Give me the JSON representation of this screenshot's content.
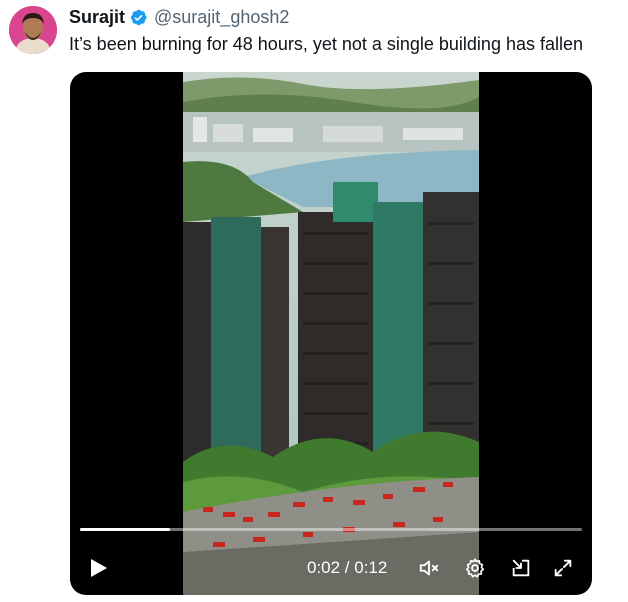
{
  "tweet": {
    "author": {
      "display_name": "Surajit",
      "handle": "@surajit_ghosh2",
      "verified": true,
      "avatar": "profile-photo"
    },
    "text": "It’s been burning for 48 hours, yet not a single building has fallen"
  },
  "video": {
    "current_time": "0:02",
    "duration": "0:12",
    "time_display": "0:02 / 0:12",
    "progress_fraction": 0.18,
    "controls": {
      "play": "play-icon",
      "mute": "volume-muted-icon",
      "settings": "gear-icon",
      "pip": "picture-in-picture-icon",
      "fullscreen": "expand-icon"
    }
  },
  "colors": {
    "verified_badge": "#1d9bf0",
    "text_primary": "#0f1419",
    "text_secondary": "#536471",
    "avatar_bg": "#d9468f"
  }
}
